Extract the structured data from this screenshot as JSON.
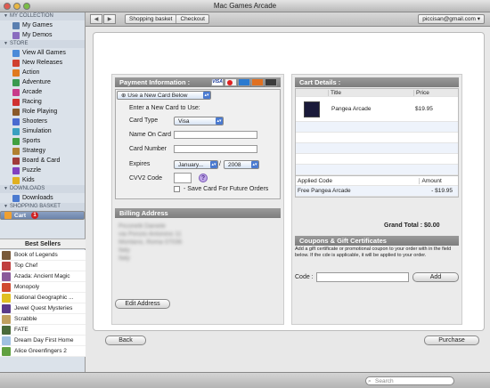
{
  "window": {
    "title": "Mac Games Arcade"
  },
  "sidebar": {
    "collection_label": "MY COLLECTION",
    "collection": [
      {
        "label": "My Games",
        "color": "#5a7fb0"
      },
      {
        "label": "My Demos",
        "color": "#8a6cbf"
      }
    ],
    "store_label": "STORE",
    "store": [
      {
        "label": "View All Games",
        "color": "#4a8ad8"
      },
      {
        "label": "New Releases",
        "color": "#d04030"
      },
      {
        "label": "Action",
        "color": "#e07a20"
      },
      {
        "label": "Adventure",
        "color": "#3a9a50"
      },
      {
        "label": "Arcade",
        "color": "#c83a8a"
      },
      {
        "label": "Racing",
        "color": "#d03030"
      },
      {
        "label": "Role Playing",
        "color": "#8a5a2a"
      },
      {
        "label": "Shooters",
        "color": "#4a6ad0"
      },
      {
        "label": "Simulation",
        "color": "#3aa0c0"
      },
      {
        "label": "Sports",
        "color": "#40a040"
      },
      {
        "label": "Strategy",
        "color": "#b08030"
      },
      {
        "label": "Board & Card",
        "color": "#a03a3a"
      },
      {
        "label": "Puzzle",
        "color": "#8040c0"
      },
      {
        "label": "Kids",
        "color": "#e0b020"
      }
    ],
    "downloads_label": "DOWNLOADS",
    "downloads": [
      {
        "label": "Downloads",
        "color": "#4a7ad0"
      }
    ],
    "basket_label": "SHOPPING BASKET",
    "cart": {
      "label": "Cart",
      "count": "1"
    }
  },
  "best_sellers": {
    "title": "Best Sellers",
    "items": [
      {
        "label": "Book of Legends",
        "color": "#7a5a3a"
      },
      {
        "label": "Top Chef",
        "color": "#c04040"
      },
      {
        "label": "Azada: Ancient Magic",
        "color": "#8a5a9a"
      },
      {
        "label": "Monopoly",
        "color": "#d04a30"
      },
      {
        "label": "National Geographic ...",
        "color": "#e0c020"
      },
      {
        "label": "Jewel Quest Mysteries",
        "color": "#5a3a8a"
      },
      {
        "label": "Scrabble",
        "color": "#c0a060"
      },
      {
        "label": "FATE",
        "color": "#4a6a3a"
      },
      {
        "label": "Dream Day First Home",
        "color": "#a0c0e0"
      },
      {
        "label": "Alice Greenfingers 2",
        "color": "#60a040"
      }
    ]
  },
  "toolbar": {
    "crumb1": "Shopping basket",
    "crumb2": "Checkout",
    "account": "piccisan@gmail.com"
  },
  "payment": {
    "header": "Payment Information :",
    "card_select": "Use a New Card Below",
    "enter_label": "Enter a New Card to Use:",
    "card_type_label": "Card Type",
    "card_type_value": "Visa",
    "name_label": "Name On Card",
    "number_label": "Card Number",
    "expires_label": "Expires",
    "month": "January...",
    "year": "2008",
    "cvv_label": "CVV2 Code",
    "save_label": "- Save Card For Future Orders"
  },
  "billing": {
    "header": "Billing Address",
    "edit_button": "Edit Address",
    "blurred": [
      "Piccinelli Daniele",
      "via Ponzio Antonino 11",
      "Montano, Roma 07036",
      "Italy",
      "Italy"
    ]
  },
  "cart_details": {
    "header": "Cart Details :",
    "col_title": "Title",
    "col_price": "Price",
    "items": [
      {
        "title": "Pangea Arcade",
        "price": "$19.95"
      }
    ],
    "applied_code_label": "Applied Code",
    "amount_label": "Amount",
    "applied_code": "Free Pangea Arcade",
    "applied_amount": "- $19.95",
    "grand_total": "Grand Total :  $0.00"
  },
  "coupons": {
    "header": "Coupons & Gift Certificates",
    "description": "Add a gift certificate or promotional coupon to your order with in the field below. If the cde is applicable, it will be applied to your order.",
    "code_label": "Code :",
    "add_button": "Add"
  },
  "footer": {
    "back": "Back",
    "purchase": "Purchase"
  },
  "status": {
    "search_placeholder": "Search"
  }
}
